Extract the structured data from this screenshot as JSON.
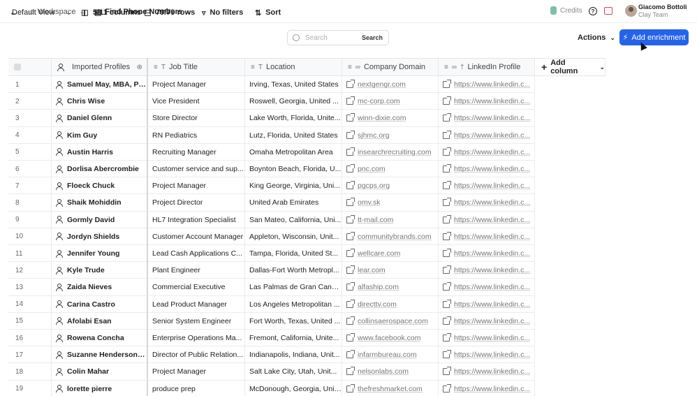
{
  "topbar": {
    "workspace": "Workspace",
    "table_name": "Find Phone Numbers",
    "credits_label": "Credits",
    "user_name": "Giacomo Bottoli",
    "user_team": "Clay Team"
  },
  "toolbar": {
    "view_label": "Default View",
    "columns_label": "5/11 columns",
    "rows_label": "79/79 rows",
    "filters_label": "No filters",
    "sort_label": "Sort",
    "search_placeholder": "Search",
    "search_button": "Search",
    "actions_label": "Actions",
    "enrich_label": "Add enrichment"
  },
  "colors": {
    "accent": "#2563eb"
  },
  "columns": [
    {
      "label": "Imported Profiles",
      "icon": "person-icon"
    },
    {
      "label": "Job Title",
      "icon": "text-icon"
    },
    {
      "label": "Location",
      "icon": "text-icon"
    },
    {
      "label": "Company Domain",
      "icon": "link-icon"
    },
    {
      "label": "LinkedIn Profile",
      "icon": "link-icon"
    }
  ],
  "add_column_label": "Add column",
  "rows": [
    {
      "n": "1",
      "name": "Samuel May, MBA, PMP",
      "title": "Project Manager",
      "loc": "Irving, Texas, United States",
      "domain": "nextgengr.com",
      "li": "https://www.linkedin.c..."
    },
    {
      "n": "2",
      "name": "Chris Wise",
      "title": "Vice President",
      "loc": "Roswell, Georgia, United ...",
      "domain": "mc-corp.com",
      "li": "https://www.linkedin.c..."
    },
    {
      "n": "3",
      "name": "Daniel Glenn",
      "title": "Store Director",
      "loc": "Lake Worth, Florida, Unite...",
      "domain": "winn-dixie.com",
      "li": "https://www.linkedin.c..."
    },
    {
      "n": "4",
      "name": "Kim Guy",
      "title": "RN Pediatrics",
      "loc": "Lutz, Florida, United States",
      "domain": "sjhmc.org",
      "li": "https://www.linkedin.c..."
    },
    {
      "n": "5",
      "name": "Austin Harris",
      "title": "Recruiting Manager",
      "loc": "Omaha Metropolitan Area",
      "domain": "insearchrecruiting.com",
      "li": "https://www.linkedin.c..."
    },
    {
      "n": "6",
      "name": "Dorlisa Abercrombie",
      "title": "Customer service and sup...",
      "loc": "Boynton Beach, Florida, U...",
      "domain": "pnc.com",
      "li": "https://www.linkedin.c..."
    },
    {
      "n": "7",
      "name": "Floeck Chuck",
      "title": "Project Manager",
      "loc": "King George, Virginia, Uni...",
      "domain": "pgcps.org",
      "li": "https://www.linkedin.c..."
    },
    {
      "n": "8",
      "name": "Shaik Mohiddin",
      "title": "Project Director",
      "loc": "United Arab Emirates",
      "domain": "omv.sk",
      "li": "https://www.linkedin.c..."
    },
    {
      "n": "9",
      "name": "Gormly David",
      "title": "HL7 Integration Specialist",
      "loc": "San Mateo, California, Uni...",
      "domain": "tt-mail.com",
      "li": "https://www.linkedin.c..."
    },
    {
      "n": "10",
      "name": "Jordyn Shields",
      "title": "Customer Account Manager",
      "loc": "Appleton, Wisconsin, Unit...",
      "domain": "communitybrands.com",
      "li": "https://www.linkedin.c..."
    },
    {
      "n": "11",
      "name": "Jennifer Young",
      "title": "Lead Cash Applications C...",
      "loc": "Tampa, Florida, United St...",
      "domain": "wellcare.com",
      "li": "https://www.linkedin.c..."
    },
    {
      "n": "12",
      "name": "Kyle Trude",
      "title": "Plant Engineer",
      "loc": "Dallas-Fort Worth Metropl...",
      "domain": "lear.com",
      "li": "https://www.linkedin.c..."
    },
    {
      "n": "13",
      "name": "Zaida Nieves",
      "title": "Commercial Executive",
      "loc": "Las Palmas de Gran Cana...",
      "domain": "alfaship.com",
      "li": "https://www.linkedin.c..."
    },
    {
      "n": "14",
      "name": "Carina Castro",
      "title": "Lead Product Manager",
      "loc": "Los Angeles Metropolitan ...",
      "domain": "directtv.com",
      "li": "https://www.linkedin.c..."
    },
    {
      "n": "15",
      "name": "Afolabi Esan",
      "title": "Senior System Engineer",
      "loc": "Fort Worth, Texas, United ...",
      "domain": "collinsaerospace.com",
      "li": "https://www.linkedin.c..."
    },
    {
      "n": "16",
      "name": "Rowena Concha",
      "title": "Enterprise Operations Ma...",
      "loc": "Fremont, California, Unite...",
      "domain": "www.facebook.com",
      "li": "https://www.linkedin.c..."
    },
    {
      "n": "17",
      "name": "Suzanne Henderson, ...",
      "title": "Director of Public Relation...",
      "loc": "Indianapolis, Indiana, Unit...",
      "domain": "infarmbureau.com",
      "li": "https://www.linkedin.c..."
    },
    {
      "n": "18",
      "name": "Colin Mahar",
      "title": "Project Manager",
      "loc": "Salt Lake City, Utah, Unit...",
      "domain": "nelsonlabs.com",
      "li": "https://www.linkedin.c..."
    },
    {
      "n": "19",
      "name": "lorette pierre",
      "title": "produce prep",
      "loc": "McDonough, Georgia, Unit...",
      "domain": "thefreshmarket.com",
      "li": "https://www.linkedin.c..."
    }
  ]
}
